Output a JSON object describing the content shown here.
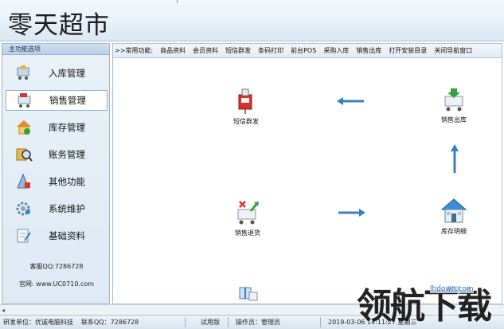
{
  "app": {
    "title": "零天超市"
  },
  "sidebar": {
    "title": "主功能选项",
    "items": [
      {
        "label": "入库管理",
        "icon": "cart-in-icon"
      },
      {
        "label": "销售管理",
        "icon": "sales-cart-icon"
      },
      {
        "label": "库存管理",
        "icon": "house-stock-icon"
      },
      {
        "label": "账务管理",
        "icon": "ledger-magnifier-icon"
      },
      {
        "label": "其他功能",
        "icon": "misc-function-icon"
      },
      {
        "label": "系统维护",
        "icon": "system-gear-icon"
      },
      {
        "label": "基础资料",
        "icon": "notebook-icon"
      }
    ],
    "service": "客服QQ:7286728",
    "website": "官网: www.UC0710.com"
  },
  "quickbar": {
    "label": ">>常用功能:",
    "items": [
      "商品资料",
      "会员资料",
      "短信群发",
      "条码打印",
      "前台POS",
      "采购入库",
      "销售出库",
      "打开安装目录",
      "关闭导航窗口"
    ]
  },
  "flow": {
    "sms": "短信群发",
    "outbound": "销售出库",
    "return": "销售退货",
    "stock": "库存明细"
  },
  "status": {
    "developer": "研发单位：优诚电脑科技",
    "qq": "联系QQ：7286728",
    "edition": "试用版",
    "operator": "操作员：管理员",
    "datetime": "2019-03-06  14:11:27  星期三"
  },
  "watermark": {
    "text": "领航下载",
    "url": "lhdown.com"
  },
  "colors": {
    "accent": "#3b7fc6",
    "panel": "#dfe9f4",
    "border": "#9db4cc"
  }
}
